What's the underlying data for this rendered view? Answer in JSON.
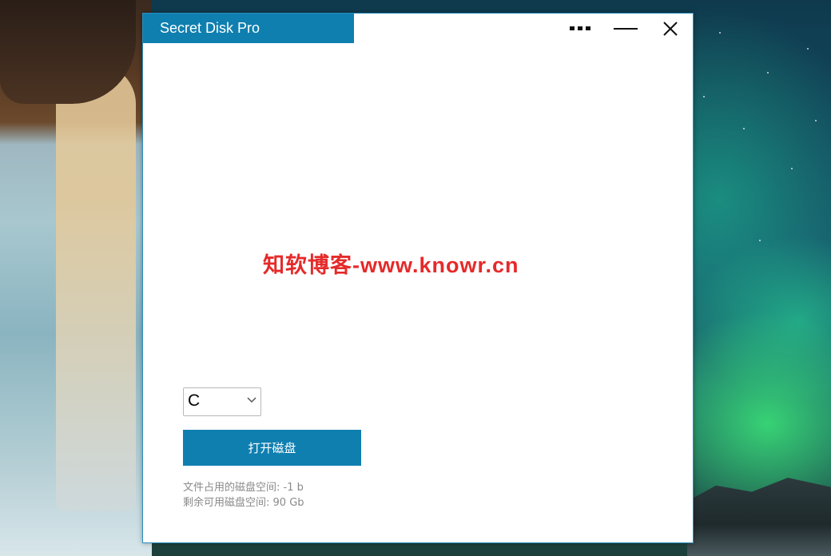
{
  "window": {
    "title": "Secret Disk Pro",
    "controls": {
      "more": "more-options",
      "minimize": "minimize",
      "close": "close"
    }
  },
  "watermark": "知软博客-www.knowr.cn",
  "drive": {
    "selected": "C"
  },
  "actions": {
    "open_disk": "打开磁盘"
  },
  "disk_info": {
    "used_label": "文件占用的磁盘空间:",
    "used_value": "-1 b",
    "free_label": "剩余可用磁盘空间:",
    "free_value": "90 Gb"
  },
  "colors": {
    "accent": "#0f7fb0",
    "watermark": "#e52a2a",
    "info_text": "#8a8a8a"
  },
  "icons": [
    "more-icon",
    "minimize-icon",
    "close-icon",
    "chevron-down-icon"
  ]
}
